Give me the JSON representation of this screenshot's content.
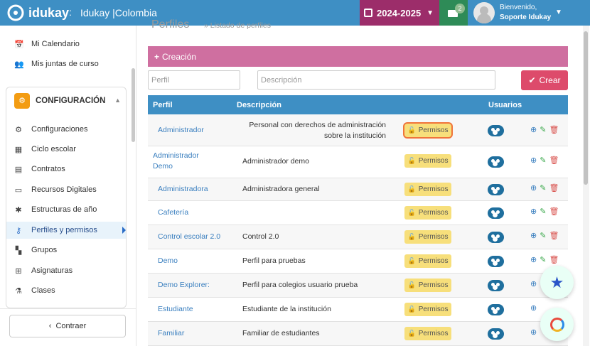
{
  "topbar": {
    "brand": "idukay",
    "separator": ":",
    "school": "Idukay |Colombia",
    "year": "2024-2025",
    "mail_count": "2",
    "welcome": "Bienvenido,",
    "user_name": "Soporte Idukay"
  },
  "sidebar": {
    "items_top": [
      {
        "label": "Mi Calendario",
        "icon": "calendar-check-icon"
      },
      {
        "label": "Mis juntas de curso",
        "icon": "users-icon"
      }
    ],
    "config_label": "CONFIGURACIÓN",
    "items_config": [
      {
        "label": "Configuraciones",
        "icon": "cogs-icon"
      },
      {
        "label": "Ciclo escolar",
        "icon": "calendar-icon"
      },
      {
        "label": "Contratos",
        "icon": "document-icon"
      },
      {
        "label": "Recursos Digitales",
        "icon": "laptop-icon"
      },
      {
        "label": "Estructuras de año",
        "icon": "gear-icon"
      },
      {
        "label": "Perfiles y permisos",
        "icon": "key-icon"
      },
      {
        "label": "Grupos",
        "icon": "sitemap-icon"
      },
      {
        "label": "Asignaturas",
        "icon": "hierarchy-icon"
      },
      {
        "label": "Clases",
        "icon": "flask-icon"
      }
    ],
    "collapse_label": "Contraer"
  },
  "main": {
    "page_title": "Perfiles",
    "page_subtitle": "» Listado de perfiles",
    "creation_label": "Creación",
    "profile_placeholder": "Perfil",
    "description_placeholder": "Descripción",
    "create_label": "Crear",
    "table": {
      "headers": {
        "perfil": "Perfil",
        "descripcion": "Descripción",
        "usuarios": "Usuarios"
      },
      "permisos_label": "Permisos",
      "rows": [
        {
          "perfil": "Administrador",
          "descripcion": "Personal con derechos de administración sobre la institución"
        },
        {
          "perfil": "Administrador Demo",
          "descripcion": "Administrador demo"
        },
        {
          "perfil": "Administradora",
          "descripcion": "Administradora general"
        },
        {
          "perfil": "Cafetería",
          "descripcion": ""
        },
        {
          "perfil": "Control escolar 2.0",
          "descripcion": "Control 2.0"
        },
        {
          "perfil": "Demo",
          "descripcion": "Perfil para pruebas"
        },
        {
          "perfil": "Demo Explorer:",
          "descripcion": "Perfil para colegios usuario prueba"
        },
        {
          "perfil": "Estudiante",
          "descripcion": "Estudiante de la institución"
        },
        {
          "perfil": "Familiar",
          "descripcion": "Familiar de estudiantes"
        }
      ]
    }
  }
}
